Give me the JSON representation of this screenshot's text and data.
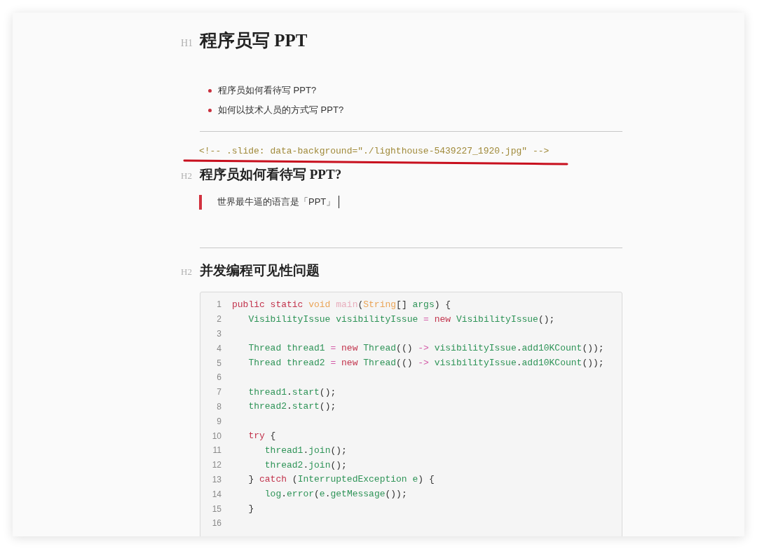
{
  "blocks": [
    {
      "kind": "h1",
      "marker": "H1",
      "text": "程序员写 PPT"
    },
    {
      "kind": "list",
      "items": [
        "程序员如何看待写 PPT?",
        "如何以技术人员的方式写 PPT?"
      ]
    },
    {
      "kind": "rule"
    },
    {
      "kind": "comment",
      "text": "<!-- .slide: data-background=\"./lighthouse-5439227_1920.jpg\" -->",
      "underlined": true
    },
    {
      "kind": "h2",
      "marker": "H2",
      "text": "程序员如何看待写 PPT?"
    },
    {
      "kind": "quote",
      "text": "世界最牛逼的语言是「PPT」",
      "cursor": true
    },
    {
      "kind": "rule"
    },
    {
      "kind": "h2",
      "marker": "H2",
      "text": "并发编程可见性问题"
    },
    {
      "kind": "code",
      "lines": [
        {
          "number": "1",
          "tokens": [
            {
              "kind": "keyword",
              "text": "public static "
            },
            {
              "kind": "type",
              "text": "void "
            },
            {
              "kind": "def",
              "text": "main"
            },
            {
              "kind": "punct",
              "text": "("
            },
            {
              "kind": "type",
              "text": "String"
            },
            {
              "kind": "punct",
              "text": "[] "
            },
            {
              "kind": "variable",
              "text": "args"
            },
            {
              "kind": "punct",
              "text": ") {"
            }
          ]
        },
        {
          "number": "2",
          "tokens": [
            {
              "kind": "variable",
              "text": "   VisibilityIssue visibilityIssue "
            },
            {
              "kind": "operator",
              "text": "= "
            },
            {
              "kind": "keyword",
              "text": "new "
            },
            {
              "kind": "variable",
              "text": "VisibilityIssue"
            },
            {
              "kind": "punct",
              "text": "();"
            }
          ]
        },
        {
          "number": "3"
        },
        {
          "number": "4",
          "tokens": [
            {
              "kind": "variable",
              "text": "   Thread thread1 "
            },
            {
              "kind": "operator",
              "text": "= "
            },
            {
              "kind": "keyword",
              "text": "new "
            },
            {
              "kind": "variable",
              "text": "Thread"
            },
            {
              "kind": "punct",
              "text": "(() "
            },
            {
              "kind": "operator",
              "text": "-> "
            },
            {
              "kind": "variable",
              "text": "visibilityIssue"
            },
            {
              "kind": "punct",
              "text": "."
            },
            {
              "kind": "variable",
              "text": "add10KCount"
            },
            {
              "kind": "punct",
              "text": "());"
            }
          ]
        },
        {
          "number": "5",
          "tokens": [
            {
              "kind": "variable",
              "text": "   Thread thread2 "
            },
            {
              "kind": "operator",
              "text": "= "
            },
            {
              "kind": "keyword",
              "text": "new "
            },
            {
              "kind": "variable",
              "text": "Thread"
            },
            {
              "kind": "punct",
              "text": "(() "
            },
            {
              "kind": "operator",
              "text": "-> "
            },
            {
              "kind": "variable",
              "text": "visibilityIssue"
            },
            {
              "kind": "punct",
              "text": "."
            },
            {
              "kind": "variable",
              "text": "add10KCount"
            },
            {
              "kind": "punct",
              "text": "());"
            }
          ]
        },
        {
          "number": "6"
        },
        {
          "number": "7",
          "tokens": [
            {
              "kind": "variable",
              "text": "   thread1"
            },
            {
              "kind": "punct",
              "text": "."
            },
            {
              "kind": "variable",
              "text": "start"
            },
            {
              "kind": "punct",
              "text": "();"
            }
          ]
        },
        {
          "number": "8",
          "tokens": [
            {
              "kind": "variable",
              "text": "   thread2"
            },
            {
              "kind": "punct",
              "text": "."
            },
            {
              "kind": "variable",
              "text": "start"
            },
            {
              "kind": "punct",
              "text": "();"
            }
          ]
        },
        {
          "number": "9"
        },
        {
          "number": "10",
          "tokens": [
            {
              "kind": "keyword",
              "text": "   try "
            },
            {
              "kind": "punct",
              "text": "{"
            }
          ]
        },
        {
          "number": "11",
          "tokens": [
            {
              "kind": "variable",
              "text": "      thread1"
            },
            {
              "kind": "punct",
              "text": "."
            },
            {
              "kind": "variable",
              "text": "join"
            },
            {
              "kind": "punct",
              "text": "();"
            }
          ]
        },
        {
          "number": "12",
          "tokens": [
            {
              "kind": "variable",
              "text": "      thread2"
            },
            {
              "kind": "punct",
              "text": "."
            },
            {
              "kind": "variable",
              "text": "join"
            },
            {
              "kind": "punct",
              "text": "();"
            }
          ]
        },
        {
          "number": "13",
          "tokens": [
            {
              "kind": "punct",
              "text": "   } "
            },
            {
              "kind": "keyword",
              "text": "catch "
            },
            {
              "kind": "punct",
              "text": "("
            },
            {
              "kind": "variable",
              "text": "InterruptedException e"
            },
            {
              "kind": "punct",
              "text": ") {"
            }
          ]
        },
        {
          "number": "14",
          "tokens": [
            {
              "kind": "variable",
              "text": "      log"
            },
            {
              "kind": "punct",
              "text": "."
            },
            {
              "kind": "variable",
              "text": "error"
            },
            {
              "kind": "punct",
              "text": "("
            },
            {
              "kind": "variable",
              "text": "e"
            },
            {
              "kind": "punct",
              "text": "."
            },
            {
              "kind": "variable",
              "text": "getMessage"
            },
            {
              "kind": "punct",
              "text": "());"
            }
          ]
        },
        {
          "number": "15",
          "tokens": [
            {
              "kind": "punct",
              "text": "   }"
            }
          ]
        },
        {
          "number": "16"
        }
      ]
    }
  ]
}
